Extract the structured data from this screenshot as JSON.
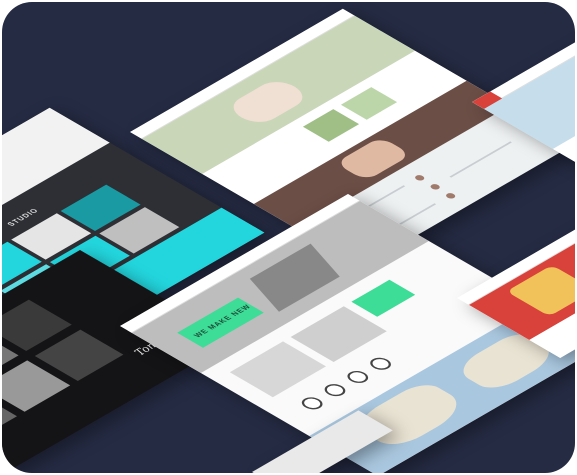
{
  "showcase": {
    "arch_banner_word": "WE MAKE NEW",
    "studio_heading": "STUDIO",
    "dark_signature": "Tom Hardy",
    "colors": {
      "background": "#252b43",
      "accent_cyan": "#23d6de",
      "accent_green": "#3ddc97",
      "wedding_brown": "#a07b6c",
      "food_red": "#d9413b"
    },
    "mockups": [
      {
        "name": "wedding-template"
      },
      {
        "name": "architecture-template"
      },
      {
        "name": "studio-template"
      },
      {
        "name": "photography-dark-template"
      },
      {
        "name": "travel-sky-template"
      },
      {
        "name": "food-template"
      }
    ]
  }
}
